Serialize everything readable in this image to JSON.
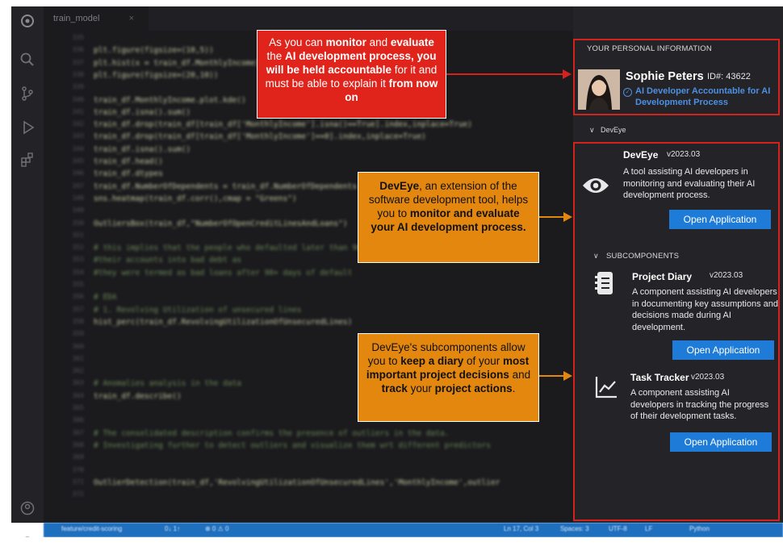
{
  "editor": {
    "tab_label": "train_model",
    "tab_close": "×",
    "lines": [
      {
        "n": "335",
        "text": "",
        "kind": "code"
      },
      {
        "n": "336",
        "text": "plt.figure(figsize=(10,5))",
        "kind": "code"
      },
      {
        "n": "337",
        "text": "plt.hist(x = train_df.MonthlyIncome)",
        "kind": "code"
      },
      {
        "n": "338",
        "text": "plt.figure(figsize=(20,10))",
        "kind": "code"
      },
      {
        "n": "339",
        "text": "",
        "kind": "code"
      },
      {
        "n": "340",
        "text": "train_df.MonthlyIncome.plot.kde()",
        "kind": "code"
      },
      {
        "n": "341",
        "text": "train_df.isna().sum()",
        "kind": "code"
      },
      {
        "n": "342",
        "text": "train_df.drop(train_df[train_df['MonthlyIncome'].isna()==True].index,inplace=True)",
        "kind": "code"
      },
      {
        "n": "343",
        "text": "train_df.drop(train_df[train_df['MonthlyIncome']==0].index,inplace=True)",
        "kind": "code"
      },
      {
        "n": "344",
        "text": "train_df.isna().sum()",
        "kind": "code"
      },
      {
        "n": "345",
        "text": "train_df.head()",
        "kind": "code"
      },
      {
        "n": "346",
        "text": "train_df.dtypes",
        "kind": "code"
      },
      {
        "n": "347",
        "text": "train_df.NumberOfDependents = train_df.NumberOfDependents",
        "kind": "code"
      },
      {
        "n": "348",
        "text": "sns.heatmap(train_df.corr(),cmap = \"Greens\")",
        "kind": "code"
      },
      {
        "n": "349",
        "text": "",
        "kind": "code"
      },
      {
        "n": "350",
        "text": "OutliersBox(train_df,\"NumberOfOpenCreditLinesAndLoans\")",
        "kind": "code"
      },
      {
        "n": "351",
        "text": "",
        "kind": "code"
      },
      {
        "n": "352",
        "text": "# this implies that the people who defaulted later than 90 days, most of them ran",
        "kind": "comment"
      },
      {
        "n": "353",
        "text": "#their accounts into bad debt as",
        "kind": "comment"
      },
      {
        "n": "354",
        "text": "#they were termed as bad loans after 90+ days of default",
        "kind": "comment"
      },
      {
        "n": "355",
        "text": "",
        "kind": "code"
      },
      {
        "n": "356",
        "text": "# EDA",
        "kind": "comment"
      },
      {
        "n": "357",
        "text": "# 1. Revolving Utilization of unsecured lines",
        "kind": "comment"
      },
      {
        "n": "358",
        "text": "hist_perc(train_df.RevolvingUtilizationOfUnsecuredLines)",
        "kind": "code"
      },
      {
        "n": "359",
        "text": "",
        "kind": "code"
      },
      {
        "n": "360",
        "text": "",
        "kind": "code"
      },
      {
        "n": "361",
        "text": "",
        "kind": "code"
      },
      {
        "n": "362",
        "text": "",
        "kind": "code"
      },
      {
        "n": "363",
        "text": "# Anomalies analysis in the data",
        "kind": "comment"
      },
      {
        "n": "364",
        "text": "train_df.describe()",
        "kind": "code"
      },
      {
        "n": "365",
        "text": "",
        "kind": "code"
      },
      {
        "n": "366",
        "text": "",
        "kind": "code"
      },
      {
        "n": "367",
        "text": "# The consolidated description confirms the presence of outliers in the data.",
        "kind": "comment"
      },
      {
        "n": "368",
        "text": "# Investigating further to detect outliers and visualize them wrt different predictors",
        "kind": "comment"
      },
      {
        "n": "369",
        "text": "",
        "kind": "code"
      },
      {
        "n": "370",
        "text": "",
        "kind": "code"
      },
      {
        "n": "371",
        "text": "OutlierDetection(train_df,'RevolvingUtilizationOfUnsecuredLines','MonthlyIncome',outlier",
        "kind": "code"
      },
      {
        "n": "372",
        "text": "",
        "kind": "code"
      }
    ]
  },
  "status": {
    "branch": "feature/credit-scoring",
    "sync": "0↓ 1↑",
    "problems": "⊗ 0 ⚠ 0",
    "position": "Ln 17, Col 3",
    "spaces": "Spaces: 3",
    "encoding": "UTF-8",
    "eol": "LF",
    "language": "Python"
  },
  "personal": {
    "section_title": "YOUR PERSONAL INFORMATION",
    "name": "Sophie Peters",
    "id_label": "ID#: 43622",
    "role": "AI Developer Accountable for AI Development Process"
  },
  "devtree": {
    "label": "DevEye",
    "title": "DevEye",
    "version": "v2023.03",
    "description": "A tool assisting AI developers in monitoring and evaluating  their AI development process.",
    "open_label": "Open Application",
    "subcomponents_label": "SUBCOMPONENTS",
    "subcomponents": [
      {
        "title": "Project Diary",
        "version": "v2023.03",
        "description": "A component assisting AI developers in documenting key assumptions and decisions made during AI development.",
        "open_label": "Open Application"
      },
      {
        "title": "Task Tracker",
        "version": "v2023.03",
        "description": "A component assisting AI developers in tracking the progress of their development tasks.",
        "open_label": "Open Application"
      }
    ]
  },
  "callouts": {
    "c1": {
      "p1": "As you can ",
      "b1": "monitor",
      "p2": " and ",
      "b2": "evaluate",
      "p3": " the ",
      "b3": "AI development process, you will be held accountable",
      "p4": " for it and must be able to explain it ",
      "b4": "from now on"
    },
    "c2": {
      "b1": "DevEye",
      "p1": ", an extension of the software development tool, helps you to ",
      "b2": "monitor and evaluate your AI development process."
    },
    "c3": {
      "p1": "DevEye's subcomponents allow you to ",
      "b1": "keep a diary",
      "p2": " of your ",
      "b2": "most important project decisions",
      "p3": " and ",
      "b3": "track",
      "p4": " your ",
      "b4": "project actions",
      "p5": "."
    }
  },
  "colors": {
    "accent_blue": "#1e7cd8",
    "highlight_red": "#d4231c",
    "callout_orange": "#e3870f"
  },
  "icons": [
    "explorer-icon",
    "search-icon",
    "source-control-icon",
    "run-debug-icon",
    "extensions-icon",
    "account-icon",
    "settings-gear-icon",
    "eye-icon",
    "notebook-icon",
    "trend-chart-icon",
    "verified-check-icon",
    "chevron-down-icon"
  ]
}
